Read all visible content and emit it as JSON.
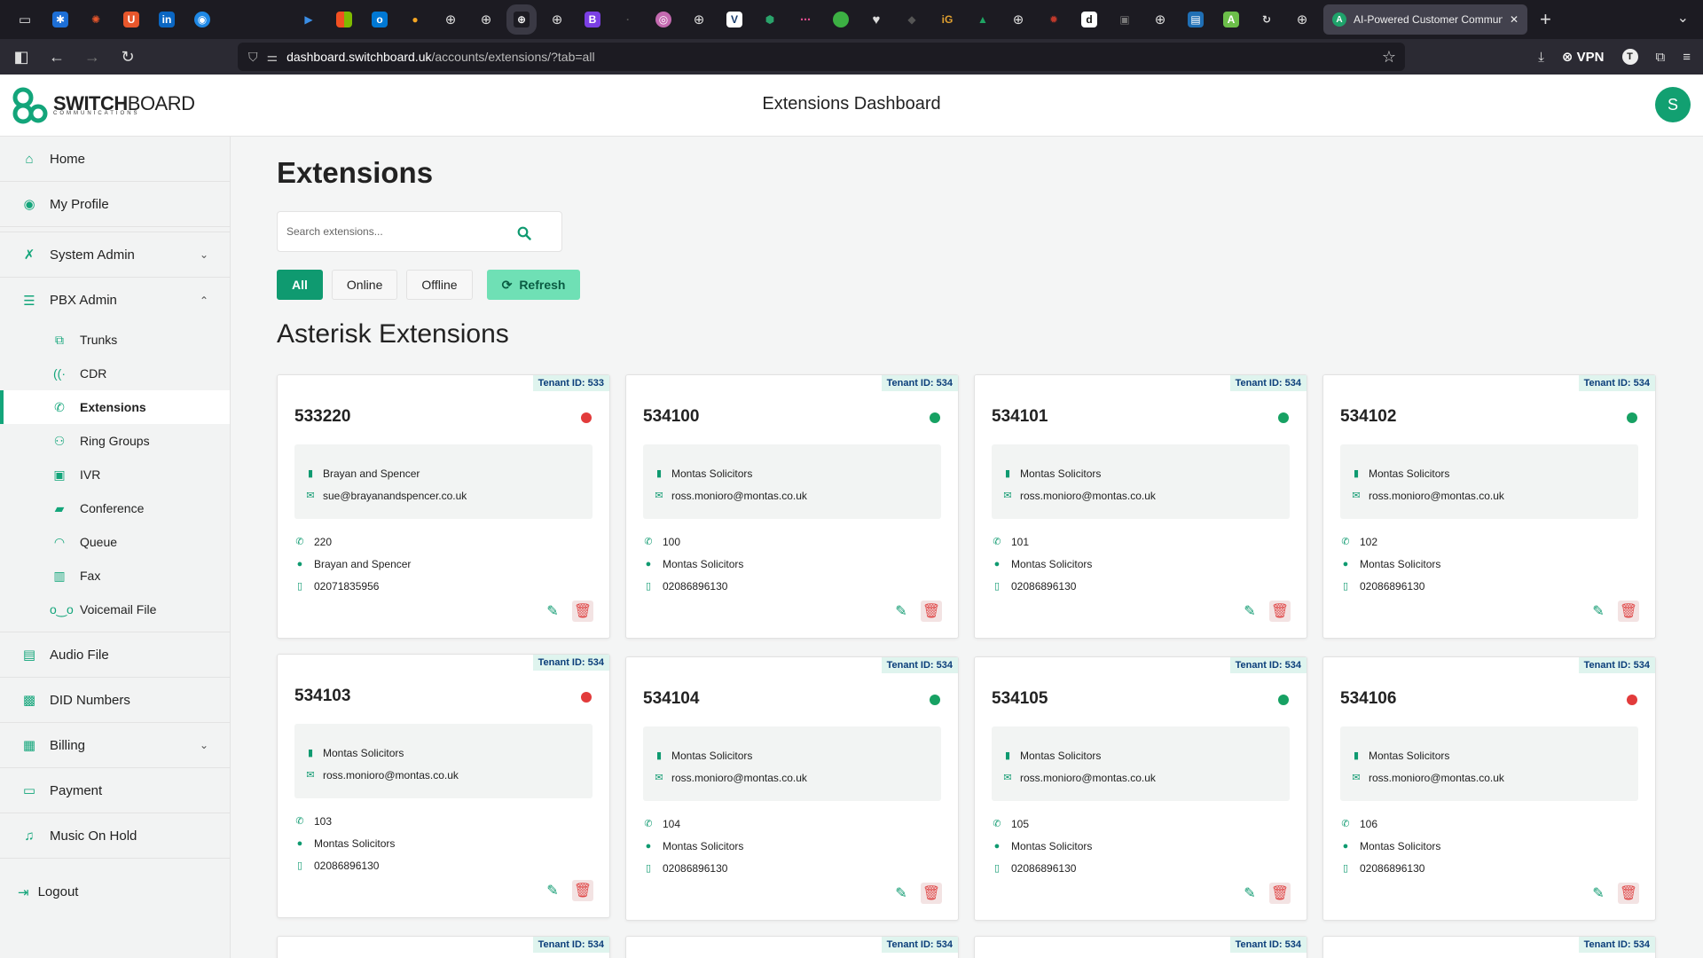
{
  "browser": {
    "open_tab_title": "AI-Powered Customer Commun",
    "url_host": "dashboard.switchboard.uk",
    "url_path": "/accounts/extensions/?tab=all",
    "vpn_label": "VPN",
    "profile_initial": "T"
  },
  "header": {
    "logo_brand_bold": "SWITCH",
    "logo_brand_regular": "BOARD",
    "logo_sub": "COMMUNICATIONS",
    "title": "Extensions Dashboard",
    "avatar_initial": "S"
  },
  "sidebar": {
    "home": "Home",
    "my_profile": "My Profile",
    "system_admin": "System Admin",
    "pbx_admin": "PBX Admin",
    "pbx_items": {
      "trunks": "Trunks",
      "cdr": "CDR",
      "extensions": "Extensions",
      "ring_groups": "Ring Groups",
      "ivr": "IVR",
      "conference": "Conference",
      "queue": "Queue",
      "fax": "Fax",
      "voicemail": "Voicemail File"
    },
    "audio_file": "Audio File",
    "did_numbers": "DID Numbers",
    "billing": "Billing",
    "payment": "Payment",
    "music_on_hold": "Music On Hold",
    "logout": "Logout"
  },
  "main": {
    "title": "Extensions",
    "search_placeholder": "Search extensions...",
    "filters": {
      "all": "All",
      "online": "Online",
      "offline": "Offline",
      "refresh": "Refresh"
    },
    "section_title": "Asterisk Extensions"
  },
  "cards": [
    {
      "tenant": "Tenant ID: 533",
      "ext": "533220",
      "status": "offline",
      "company": "Brayan and Spencer",
      "email": "sue@brayanandspencer.co.uk",
      "number": "220",
      "user": "Brayan and Spencer",
      "phone": "02071835956"
    },
    {
      "tenant": "Tenant ID: 534",
      "ext": "534100",
      "status": "online",
      "company": "Montas Solicitors",
      "email": "ross.monioro@montas.co.uk",
      "number": "100",
      "user": "Montas Solicitors",
      "phone": "02086896130"
    },
    {
      "tenant": "Tenant ID: 534",
      "ext": "534101",
      "status": "online",
      "company": "Montas Solicitors",
      "email": "ross.monioro@montas.co.uk",
      "number": "101",
      "user": "Montas Solicitors",
      "phone": "02086896130"
    },
    {
      "tenant": "Tenant ID: 534",
      "ext": "534102",
      "status": "online",
      "company": "Montas Solicitors",
      "email": "ross.monioro@montas.co.uk",
      "number": "102",
      "user": "Montas Solicitors",
      "phone": "02086896130"
    },
    {
      "tenant": "Tenant ID: 534",
      "ext": "534103",
      "status": "offline",
      "company": "Montas Solicitors",
      "email": "ross.monioro@montas.co.uk",
      "number": "103",
      "user": "Montas Solicitors",
      "phone": "02086896130"
    },
    {
      "tenant": "Tenant ID: 534",
      "ext": "534104",
      "status": "online",
      "company": "Montas Solicitors",
      "email": "ross.monioro@montas.co.uk",
      "number": "104",
      "user": "Montas Solicitors",
      "phone": "02086896130"
    },
    {
      "tenant": "Tenant ID: 534",
      "ext": "534105",
      "status": "online",
      "company": "Montas Solicitors",
      "email": "ross.monioro@montas.co.uk",
      "number": "105",
      "user": "Montas Solicitors",
      "phone": "02086896130"
    },
    {
      "tenant": "Tenant ID: 534",
      "ext": "534106",
      "status": "offline",
      "company": "Montas Solicitors",
      "email": "ross.monioro@montas.co.uk",
      "number": "106",
      "user": "Montas Solicitors",
      "phone": "02086896130"
    }
  ],
  "partial_cards": [
    "Tenant ID: 534",
    "Tenant ID: 534",
    "Tenant ID: 534",
    "Tenant ID: 534"
  ],
  "colors": {
    "accent": "#0f9a70",
    "online": "#17a163",
    "offline": "#e23b3b"
  }
}
